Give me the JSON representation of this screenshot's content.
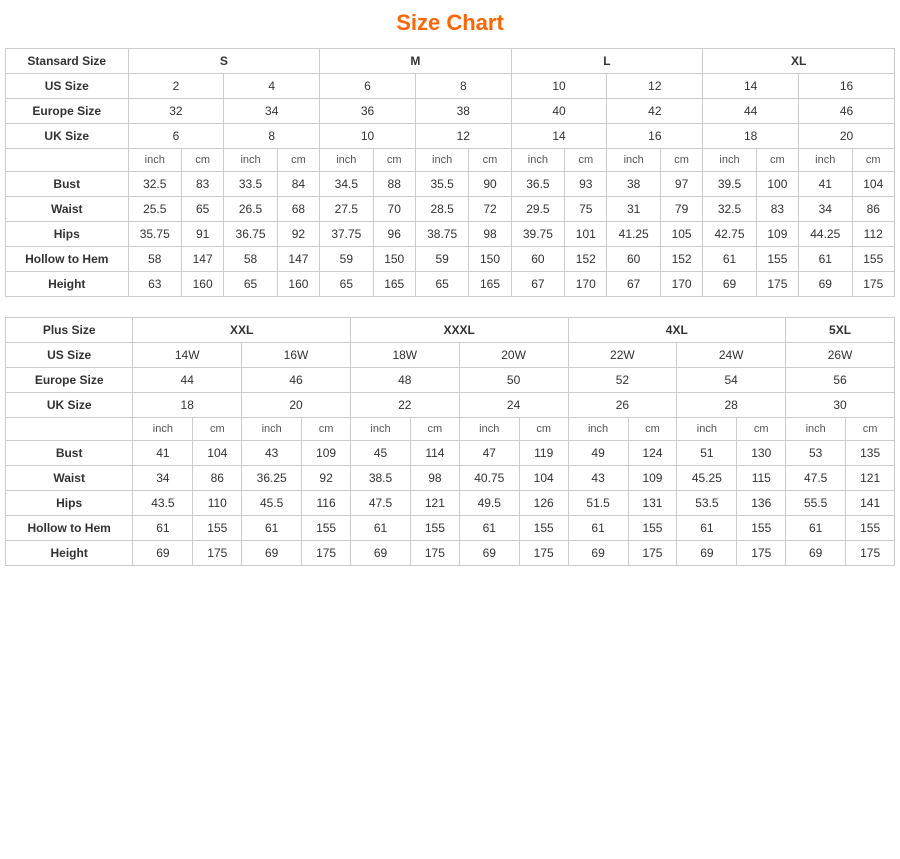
{
  "title": "Size Chart",
  "standard": {
    "table1_headers": [
      "Stansard Size",
      "S",
      "",
      "M",
      "",
      "L",
      "",
      "XL",
      ""
    ],
    "us_sizes": [
      "US Size",
      "2",
      "4",
      "6",
      "8",
      "10",
      "12",
      "14",
      "16"
    ],
    "europe_sizes": [
      "Europe Size",
      "32",
      "34",
      "36",
      "38",
      "40",
      "42",
      "44",
      "46"
    ],
    "uk_sizes": [
      "UK Size",
      "6",
      "8",
      "10",
      "12",
      "14",
      "16",
      "18",
      "20"
    ],
    "units": [
      "",
      "inch",
      "cm",
      "inch",
      "cm",
      "inch",
      "cm",
      "inch",
      "cm",
      "inch",
      "cm",
      "inch",
      "cm",
      "inch",
      "cm",
      "inch",
      "cm"
    ],
    "bust": [
      "Bust",
      "32.5",
      "83",
      "33.5",
      "84",
      "34.5",
      "88",
      "35.5",
      "90",
      "36.5",
      "93",
      "38",
      "97",
      "39.5",
      "100",
      "41",
      "104"
    ],
    "waist": [
      "Waist",
      "25.5",
      "65",
      "26.5",
      "68",
      "27.5",
      "70",
      "28.5",
      "72",
      "29.5",
      "75",
      "31",
      "79",
      "32.5",
      "83",
      "34",
      "86"
    ],
    "hips": [
      "Hips",
      "35.75",
      "91",
      "36.75",
      "92",
      "37.75",
      "96",
      "38.75",
      "98",
      "39.75",
      "101",
      "41.25",
      "105",
      "42.75",
      "109",
      "44.25",
      "112"
    ],
    "hollow": [
      "Hollow to Hem",
      "58",
      "147",
      "58",
      "147",
      "59",
      "150",
      "59",
      "150",
      "60",
      "152",
      "60",
      "152",
      "61",
      "155",
      "61",
      "155"
    ],
    "height": [
      "Height",
      "63",
      "160",
      "65",
      "160",
      "65",
      "165",
      "65",
      "165",
      "67",
      "170",
      "67",
      "170",
      "69",
      "175",
      "69",
      "175"
    ]
  },
  "plus": {
    "table2_headers": [
      "Plus Size",
      "XXL",
      "",
      "XXXL",
      "",
      "4XL",
      "",
      "5XL"
    ],
    "us_sizes": [
      "US Size",
      "14W",
      "16W",
      "18W",
      "20W",
      "22W",
      "24W",
      "26W"
    ],
    "europe_sizes": [
      "Europe Size",
      "44",
      "46",
      "48",
      "50",
      "52",
      "54",
      "56"
    ],
    "uk_sizes": [
      "UK Size",
      "18",
      "20",
      "22",
      "24",
      "26",
      "28",
      "30"
    ],
    "units": [
      "",
      "inch",
      "cm",
      "inch",
      "cm",
      "inch",
      "cm",
      "inch",
      "cm",
      "inch",
      "cm",
      "inch",
      "cm",
      "inch",
      "cm"
    ],
    "bust": [
      "Bust",
      "41",
      "104",
      "43",
      "109",
      "45",
      "114",
      "47",
      "119",
      "49",
      "124",
      "51",
      "130",
      "53",
      "135"
    ],
    "waist": [
      "Waist",
      "34",
      "86",
      "36.25",
      "92",
      "38.5",
      "98",
      "40.75",
      "104",
      "43",
      "109",
      "45.25",
      "115",
      "47.5",
      "121"
    ],
    "hips": [
      "Hips",
      "43.5",
      "110",
      "45.5",
      "116",
      "47.5",
      "121",
      "49.5",
      "126",
      "51.5",
      "131",
      "53.5",
      "136",
      "55.5",
      "141"
    ],
    "hollow": [
      "Hollow to Hem",
      "61",
      "155",
      "61",
      "155",
      "61",
      "155",
      "61",
      "155",
      "61",
      "155",
      "61",
      "155",
      "61",
      "155"
    ],
    "height": [
      "Height",
      "69",
      "175",
      "69",
      "175",
      "69",
      "175",
      "69",
      "175",
      "69",
      "175",
      "69",
      "175",
      "69",
      "175"
    ]
  }
}
